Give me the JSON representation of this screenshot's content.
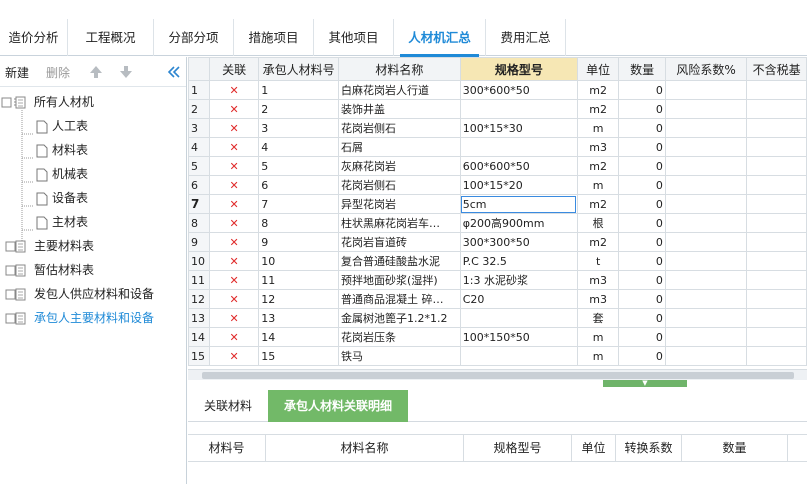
{
  "top_tabs": [
    "造价分析",
    "工程概况",
    "分部分项",
    "措施项目",
    "其他项目",
    "人材机汇总",
    "费用汇总"
  ],
  "active_tab": "人材机汇总",
  "left_toolbar": {
    "new_label": "新建",
    "delete_label": "删除"
  },
  "tree": {
    "root": "所有人材机",
    "children": [
      "人工表",
      "材料表",
      "机械表",
      "设备表",
      "主材表"
    ],
    "others": [
      "主要材料表",
      "暂估材料表",
      "发包人供应材料和设备",
      "承包人主要材料和设备"
    ],
    "selected": "承包人主要材料和设备"
  },
  "grid": {
    "columns": [
      "",
      "关联",
      "承包人材料号",
      "材料名称",
      "规格型号",
      "单位",
      "数量",
      "风险系数%",
      "不含税基"
    ],
    "rows": [
      {
        "no": "1",
        "code": "1",
        "name": "白麻花岗岩人行道",
        "spec": "300*600*50",
        "unit": "m2",
        "qty": "0"
      },
      {
        "no": "2",
        "code": "2",
        "name": "装饰井盖",
        "spec": "",
        "unit": "m2",
        "qty": "0"
      },
      {
        "no": "3",
        "code": "3",
        "name": "花岗岩侧石",
        "spec": "100*15*30",
        "unit": "m",
        "qty": "0"
      },
      {
        "no": "4",
        "code": "4",
        "name": "石屑",
        "spec": "",
        "unit": "m3",
        "qty": "0"
      },
      {
        "no": "5",
        "code": "5",
        "name": "灰麻花岗岩",
        "spec": "600*600*50",
        "unit": "m2",
        "qty": "0"
      },
      {
        "no": "6",
        "code": "6",
        "name": "花岗岩侧石",
        "spec": "100*15*20",
        "unit": "m",
        "qty": "0"
      },
      {
        "no": "7",
        "code": "7",
        "name": "异型花岗岩",
        "spec": "5cm",
        "unit": "m2",
        "qty": "0"
      },
      {
        "no": "8",
        "code": "8",
        "name": "柱状黑麻花岗岩车…",
        "spec": "φ200高900mm",
        "unit": "根",
        "qty": "0"
      },
      {
        "no": "9",
        "code": "9",
        "name": "花岗岩盲道砖",
        "spec": "300*300*50",
        "unit": "m2",
        "qty": "0"
      },
      {
        "no": "10",
        "code": "10",
        "name": "复合普通硅酸盐水泥",
        "spec": "P.C 32.5",
        "unit": "t",
        "qty": "0"
      },
      {
        "no": "11",
        "code": "11",
        "name": "预拌地面砂浆(湿拌)",
        "spec": "1:3 水泥砂浆",
        "unit": "m3",
        "qty": "0"
      },
      {
        "no": "12",
        "code": "12",
        "name": "普通商品混凝土 碎…",
        "spec": "C20",
        "unit": "m3",
        "qty": "0"
      },
      {
        "no": "13",
        "code": "13",
        "name": "金属树池篦子1.2*1.2",
        "spec": "",
        "unit": "套",
        "qty": "0"
      },
      {
        "no": "14",
        "code": "14",
        "name": "花岗岩压条",
        "spec": "100*150*50",
        "unit": "m",
        "qty": "0"
      },
      {
        "no": "15",
        "code": "15",
        "name": "铁马",
        "spec": "",
        "unit": "m",
        "qty": "0"
      }
    ],
    "current_row": "7",
    "link_mark": "✕"
  },
  "bottom_tabs": [
    "关联材料",
    "承包人材料关联明细"
  ],
  "bottom_active": "承包人材料关联明细",
  "bottom_columns": [
    "材料号",
    "材料名称",
    "规格型号",
    "单位",
    "转换系数",
    "数量"
  ],
  "colors": {
    "accent": "#1f8ad7",
    "green_tab": "#72b968",
    "highlight_header": "#f6e7b4",
    "link_red": "#e02b2b"
  }
}
